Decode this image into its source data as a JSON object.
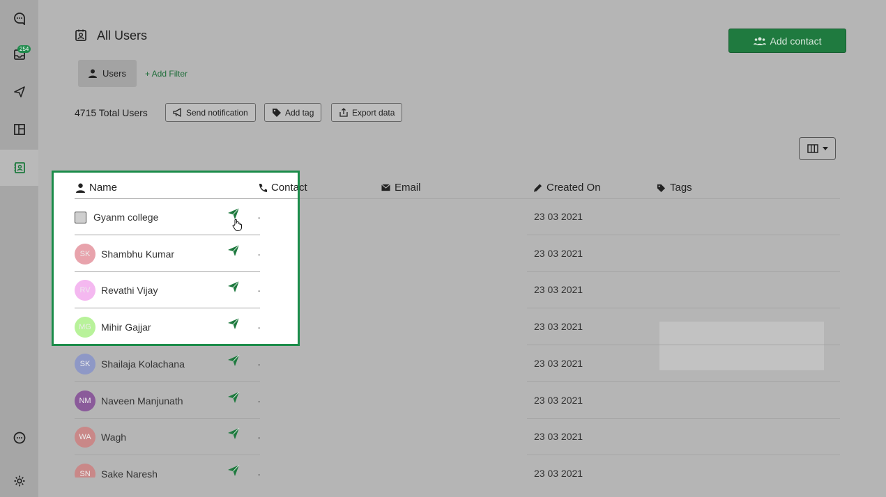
{
  "sidebar": {
    "inbox_badge": "254"
  },
  "header": {
    "title": "All Users",
    "add_contact_label": "Add contact"
  },
  "filters": {
    "users_chip": "Users",
    "add_filter": "+ Add Filter"
  },
  "toolbar": {
    "total_users": "4715 Total Users",
    "send_notification": "Send notification",
    "add_tag": "Add tag",
    "export_data": "Export data"
  },
  "table": {
    "columns": {
      "name": "Name",
      "contact": "Contact",
      "email": "Email",
      "created_on": "Created On",
      "tags": "Tags"
    },
    "rows": [
      {
        "initials": "",
        "name": "Gyanm college",
        "contact": "-",
        "created_on": "23 03 2021",
        "avatar_color": ""
      },
      {
        "initials": "SK",
        "name": "Shambhu Kumar",
        "contact": "-",
        "created_on": "23 03 2021",
        "avatar_color": "#e8a3ac"
      },
      {
        "initials": "RV",
        "name": "Revathi Vijay",
        "contact": "-",
        "created_on": "23 03 2021",
        "avatar_color": "#f4b8f0"
      },
      {
        "initials": "MG",
        "name": "Mihir Gajjar",
        "contact": "-",
        "created_on": "23 03 2021",
        "avatar_color": "#b8f29a"
      },
      {
        "initials": "SK",
        "name": "Shailaja Kolachana",
        "contact": "-",
        "created_on": "23 03 2021",
        "avatar_color": "#8e98c6"
      },
      {
        "initials": "NM",
        "name": "Naveen Manjunath",
        "contact": "-",
        "created_on": "23 03 2021",
        "avatar_color": "#8a5a9a"
      },
      {
        "initials": "WA",
        "name": "Wagh",
        "contact": "-",
        "created_on": "23 03 2021",
        "avatar_color": "#c98888"
      },
      {
        "initials": "SN",
        "name": "Sake Naresh",
        "contact": "-",
        "created_on": "23 03 2021",
        "avatar_color": "#c98888"
      }
    ]
  },
  "colors": {
    "accent": "#1f7a3f",
    "highlight": "#1b8c4a",
    "background": "#b5b5b5"
  }
}
